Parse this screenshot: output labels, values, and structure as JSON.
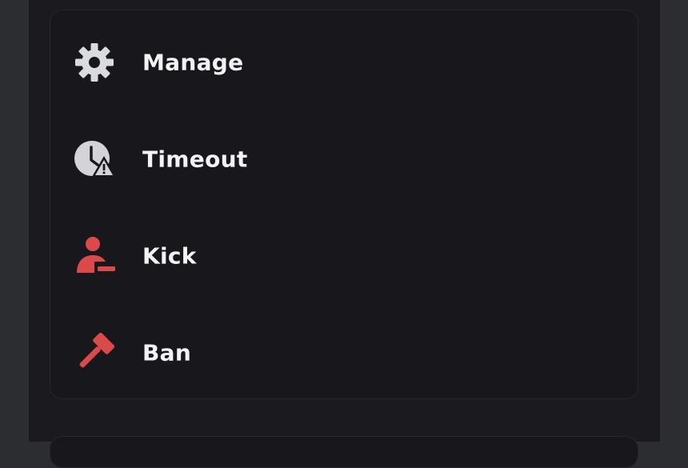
{
  "menu": {
    "items": [
      {
        "label": "Manage",
        "icon": "gear-icon",
        "color": "#dadbde"
      },
      {
        "label": "Timeout",
        "icon": "clock-warning-icon",
        "color": "#d4d4d8"
      },
      {
        "label": "Kick",
        "icon": "user-remove-icon",
        "color": "#da4a4a"
      },
      {
        "label": "Ban",
        "icon": "hammer-icon",
        "color": "#da4a4a"
      }
    ]
  },
  "colors": {
    "background": "#2b2d31",
    "panel": "#1a1a1f",
    "card": "#18181c",
    "text": "#f2f3f5",
    "danger": "#da4a4a"
  }
}
